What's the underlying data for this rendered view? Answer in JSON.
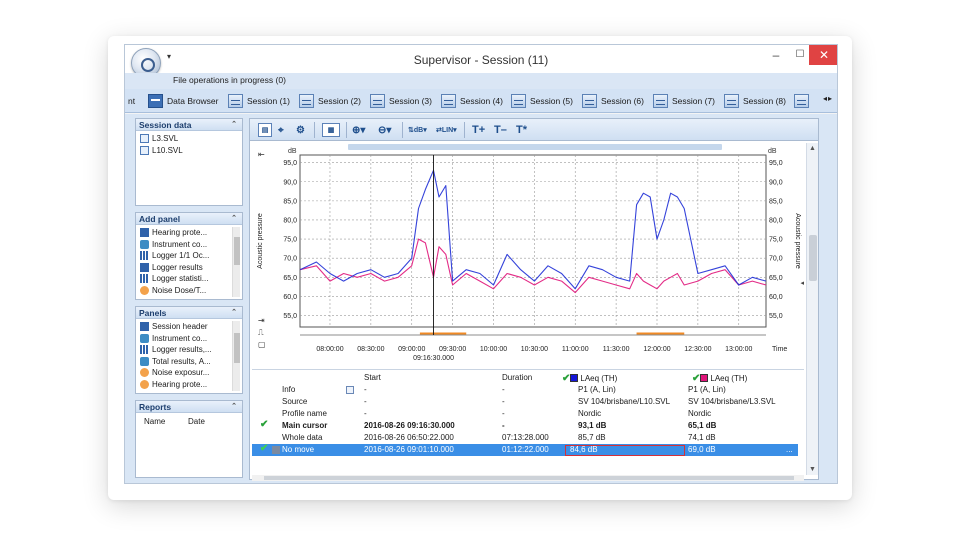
{
  "window": {
    "title": "Supervisor - Session (11)",
    "qat_glyph": "▾",
    "minimize": "–",
    "maximize": "☐",
    "close": "✕",
    "status": "File operations in progress (0)"
  },
  "tabs": {
    "first_partial": "nt",
    "items": [
      {
        "label": "Data Browser",
        "icon": "data-browser-icon"
      },
      {
        "label": "Session (1)",
        "icon": "session-icon"
      },
      {
        "label": "Session (2)",
        "icon": "session-icon"
      },
      {
        "label": "Session (3)",
        "icon": "session-icon"
      },
      {
        "label": "Session (4)",
        "icon": "session-icon"
      },
      {
        "label": "Session (5)",
        "icon": "session-icon"
      },
      {
        "label": "Session (6)",
        "icon": "session-icon"
      },
      {
        "label": "Session (7)",
        "icon": "session-icon"
      },
      {
        "label": "Session (8)",
        "icon": "session-icon"
      }
    ],
    "arrows": "◂▸"
  },
  "left": {
    "session_data": {
      "title": "Session data",
      "files": [
        "L3.SVL",
        "L10.SVL"
      ]
    },
    "add_panel": {
      "title": "Add panel",
      "items": [
        "Hearing prote...",
        "Instrument co...",
        "Logger 1/1 Oc...",
        "Logger results",
        "Logger statisti...",
        "Noise Dose/T..."
      ]
    },
    "panels": {
      "title": "Panels",
      "items": [
        "Session header",
        "Instrument co...",
        "Logger results,...",
        "Total results, A...",
        "Noise exposur...",
        "Hearing prote..."
      ]
    },
    "reports": {
      "title": "Reports",
      "col_name": "Name",
      "col_date": "Date"
    }
  },
  "toolbar": {
    "lin_label": "LIN",
    "db_label": "dB",
    "t_plus": "T+",
    "t_minus": "T–",
    "t_star": "T*"
  },
  "chart_data": {
    "type": "line",
    "y_unit": "dB",
    "ylabel": "Acoustic pressure",
    "xlabel_unit": "Time",
    "ylim": [
      52.0,
      97.0
    ],
    "y_ticks": [
      "95,0",
      "90,0",
      "85,0",
      "80,0",
      "75,0",
      "70,0",
      "65,0",
      "60,0",
      "55,0"
    ],
    "x_ticks": [
      "08:00:00",
      "08:30:00",
      "09:00:00",
      "09:30:00",
      "10:00:00",
      "10:30:00",
      "11:00:00",
      "11:30:00",
      "12:00:00",
      "12:30:00",
      "13:00:00"
    ],
    "cursor_label": "09:16:30.000",
    "series": [
      {
        "name": "LAeq (TH)",
        "color": "#1f2fd6",
        "x": [
          "07:38",
          "07:50",
          "08:00",
          "08:10",
          "08:20",
          "08:30",
          "08:40",
          "08:50",
          "09:00",
          "09:05",
          "09:10",
          "09:16",
          "09:20",
          "09:25",
          "09:30",
          "09:40",
          "09:50",
          "10:00",
          "10:10",
          "10:20",
          "10:30",
          "10:40",
          "10:50",
          "11:00",
          "11:10",
          "11:20",
          "11:30",
          "11:40",
          "11:45",
          "11:50",
          "11:55",
          "12:00",
          "12:05",
          "12:10",
          "12:15",
          "12:20",
          "12:30",
          "12:40",
          "12:50",
          "13:00",
          "13:10",
          "13:20"
        ],
        "values": [
          67,
          69,
          66,
          64,
          66,
          67,
          65,
          66,
          70,
          83,
          88,
          93,
          86,
          89,
          64,
          67,
          66,
          63,
          71,
          67,
          64,
          68,
          66,
          62,
          68,
          67,
          65,
          64,
          84,
          87,
          86,
          75,
          80,
          87,
          86,
          83,
          66,
          67,
          68,
          63,
          65,
          64
        ]
      },
      {
        "name": "LAeq (TH)",
        "color": "#e0157a",
        "x": [
          "07:38",
          "07:50",
          "08:00",
          "08:10",
          "08:20",
          "08:30",
          "08:40",
          "08:50",
          "09:00",
          "09:05",
          "09:10",
          "09:16",
          "09:20",
          "09:25",
          "09:30",
          "09:40",
          "09:50",
          "10:00",
          "10:10",
          "10:20",
          "10:30",
          "10:40",
          "10:50",
          "11:00",
          "11:10",
          "11:20",
          "11:30",
          "11:40",
          "11:45",
          "11:50",
          "11:55",
          "12:00",
          "12:05",
          "12:10",
          "12:15",
          "12:20",
          "12:30",
          "12:40",
          "12:50",
          "13:00",
          "13:10",
          "13:20"
        ],
        "values": [
          67,
          68,
          64,
          66,
          65,
          66,
          64,
          65,
          68,
          75,
          74,
          65,
          73,
          71,
          63,
          66,
          64,
          62,
          66,
          65,
          63,
          65,
          64,
          61,
          65,
          64,
          63,
          62,
          66,
          64,
          63,
          62,
          64,
          65,
          66,
          63,
          64,
          66,
          67,
          63,
          64,
          63
        ]
      }
    ]
  },
  "table": {
    "headers": {
      "start": "Start",
      "duration": "Duration"
    },
    "series1_name": "LAeq (TH)",
    "series2_name": "LAeq (TH)",
    "series1_color": "#1616d8",
    "series2_color": "#e0157a",
    "rows": [
      {
        "label": "Info",
        "start": "-",
        "duration": "-",
        "s1": "P1 (A, Lin)",
        "s2": "P1 (A, Lin)"
      },
      {
        "label": "Source",
        "start": "-",
        "duration": "-",
        "s1": "SV 104/brisbane/L10.SVL",
        "s2": "SV 104/brisbane/L3.SVL"
      },
      {
        "label": "Profile name",
        "start": "-",
        "duration": "-",
        "s1": "Nordic",
        "s2": "Nordic"
      },
      {
        "label": "Main cursor",
        "start": "2016-08-26 09:16:30.000",
        "duration": "-",
        "s1": "93,1 dB",
        "s2": "65,1 dB"
      },
      {
        "label": "Whole data",
        "start": "2016-08-26 06:50:22.000",
        "duration": "07:13:28.000",
        "s1": "85,7 dB",
        "s2": "74,1 dB"
      },
      {
        "label": "No move",
        "start": "2016-08-26 09:01:10.000",
        "duration": "01:12:22.000",
        "s1": "84,6 dB",
        "s2": "69,0 dB"
      }
    ],
    "more": "..."
  }
}
